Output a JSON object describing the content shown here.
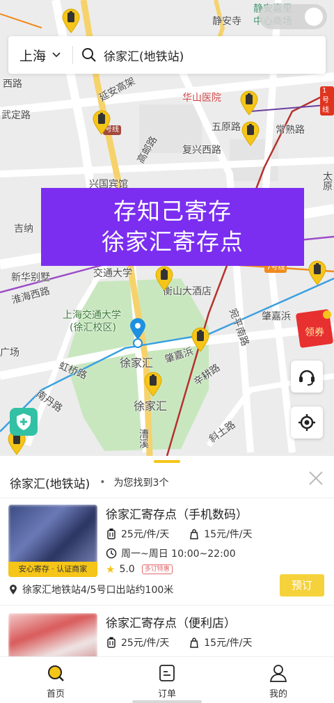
{
  "search": {
    "city": "上海",
    "query": "徐家汇(地铁站)"
  },
  "banner": {
    "line1": "存知己寄存",
    "line2": "徐家汇寄存点"
  },
  "map": {
    "top_right_label_line1": "静安嘉里",
    "top_right_label_line2": "中心商场",
    "coupon_label": "领券",
    "labels": {
      "jingansi": "静安寺",
      "changshu_rd": "常熟路",
      "huashan_hospital": "华山医院",
      "wuyuan_rd": "五原路",
      "fuxing_west_rd": "复兴西路",
      "gaoyou_rd": "高邮路",
      "xingguo_hotel": "兴国宾馆",
      "wukang_rd": "武夷路",
      "jiana": "吉纳",
      "xinhua_villa": "新华别墅",
      "huaihai_west_rd": "淮海西路",
      "jiaotong_univ": "交通大学",
      "sjtu_1": "上海交通大学",
      "sjtu_2": "(徐汇校区)",
      "hengshan_hotel": "衡山大酒店",
      "zhaojiabang_1": "肇嘉浜",
      "zhaojiabang_2": "肇嘉浜",
      "xujiahui_station_1": "徐家汇",
      "xujiahui_station_2": "徐家汇",
      "hongqiao_rd": "虹桥路",
      "wanping_rd": "宛平南路",
      "xingeng_rd": "辛耕路",
      "nandan_rd": "南丹路",
      "caoxi": "漕溪",
      "xieping_rd": "斜土路",
      "yan_an": "延安高架",
      "xi_road": "西路",
      "wu_ding": "武定路",
      "tai_yuan": "太原",
      "square": "广场",
      "line7": "7号线",
      "line1": "1号线",
      "line_x": "号线"
    }
  },
  "sheet": {
    "location_title": "徐家汇(地铁站)",
    "dot": "•",
    "found_text": "为您找到3个"
  },
  "cards": [
    {
      "name": "徐家汇寄存点（手机数码）",
      "badge": "安心寄存 · 认证商家",
      "price_large": "25元/件/天",
      "price_small": "15元/件/天",
      "hours": "周一~周日 10:00~22:00",
      "rating": "5.0",
      "tag": "多订特惠",
      "address": "徐家汇地铁站4/5号口出站约100米",
      "book_label": "预订"
    },
    {
      "name": "徐家汇寄存点（便利店）",
      "price_large": "25元/件/天",
      "price_small": "15元/件/天"
    }
  ],
  "tabs": [
    {
      "label": "首页"
    },
    {
      "label": "订单"
    },
    {
      "label": "我的"
    }
  ],
  "colors": {
    "accent_yellow": "#f5c518",
    "banner_purple": "#7b2ef0",
    "shield_green": "#32c1a4"
  }
}
